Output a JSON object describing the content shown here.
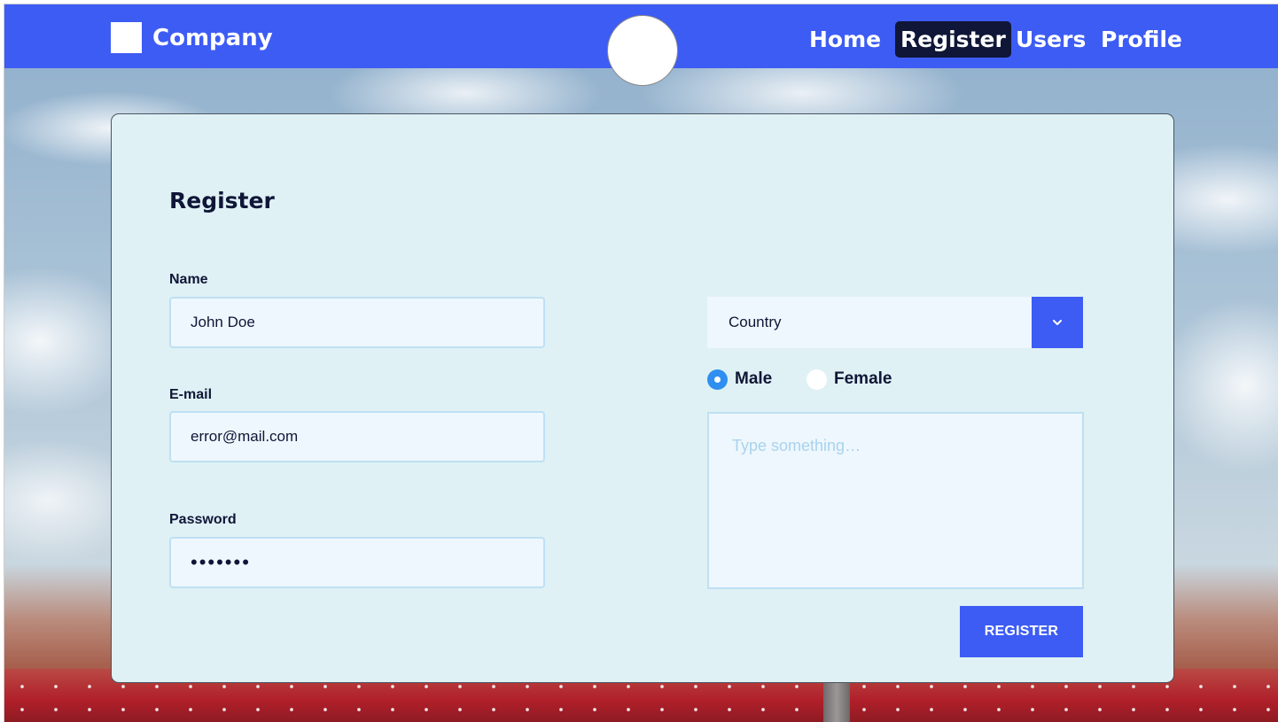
{
  "header": {
    "brand": "Company",
    "nav": [
      {
        "label": "Home",
        "active": false
      },
      {
        "label": "Register",
        "active": true
      },
      {
        "label": "Users",
        "active": false
      },
      {
        "label": "Profile",
        "active": false
      }
    ]
  },
  "form": {
    "title": "Register",
    "name": {
      "label": "Name",
      "value": "John Doe"
    },
    "email": {
      "label": "E-mail",
      "value": "error@mail.com"
    },
    "password": {
      "label": "Password",
      "value": "•••••••"
    },
    "country": {
      "selected": "Country",
      "icon": "chevron-down-icon"
    },
    "gender": {
      "options": [
        {
          "label": "Male",
          "checked": true
        },
        {
          "label": "Female",
          "checked": false
        }
      ]
    },
    "message": {
      "placeholder": "Type something…",
      "value": ""
    },
    "submit_label": "REGISTER"
  },
  "colors": {
    "header": "#3d5cf4",
    "active_nav": "#0f1637",
    "card": "#dff1f4",
    "input_bg": "#eef7fd",
    "input_border": "#bfe0f3",
    "radio_checked": "#2f8ff0",
    "text_dark": "#0f1637"
  }
}
